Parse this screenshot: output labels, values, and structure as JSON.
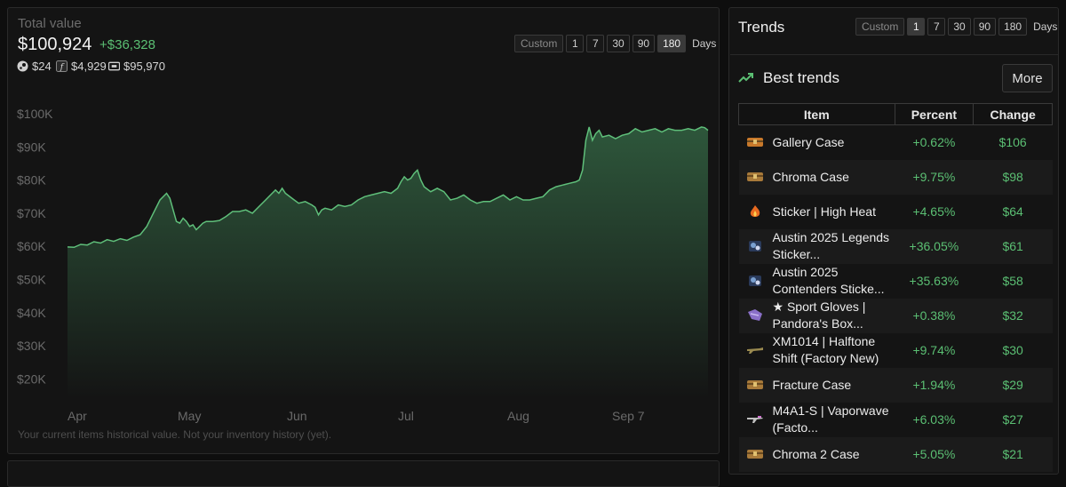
{
  "overview": {
    "total_label": "Total value",
    "total_value": "$100,924",
    "total_delta": "+$36,328",
    "breakdown": [
      {
        "icon": "steam-icon",
        "value": "$24"
      },
      {
        "icon": "skinport-f-icon",
        "value": "$4,929"
      },
      {
        "icon": "wallet-icon",
        "value": "$95,970"
      }
    ],
    "ranges": {
      "custom": "Custom",
      "options": [
        "1",
        "7",
        "30",
        "90",
        "180"
      ],
      "active": "180",
      "unit": "Days"
    },
    "footnote": "Your current items historical value. Not your inventory history (yet)."
  },
  "chart_data": {
    "type": "area",
    "ylabels": [
      "$100K",
      "$90K",
      "$80K",
      "$70K",
      "$60K",
      "$50K",
      "$40K",
      "$30K",
      "$20K"
    ],
    "xlabels": [
      "Apr",
      "May",
      "Jun",
      "Jul",
      "Aug",
      "Sep 7"
    ],
    "ylim": [
      15000,
      100000
    ],
    "x_range_days": [
      0,
      174
    ],
    "xlabel_days": [
      0,
      30,
      60,
      90,
      120,
      149
    ],
    "color": "#5fbf7a",
    "points": [
      [
        0,
        59800
      ],
      [
        2,
        59700
      ],
      [
        4,
        60600
      ],
      [
        6,
        60400
      ],
      [
        8,
        61400
      ],
      [
        10,
        61000
      ],
      [
        12,
        62000
      ],
      [
        14,
        61500
      ],
      [
        16,
        62300
      ],
      [
        18,
        61800
      ],
      [
        20,
        62800
      ],
      [
        22,
        63500
      ],
      [
        24,
        66000
      ],
      [
        26,
        70000
      ],
      [
        28,
        74000
      ],
      [
        30,
        76000
      ],
      [
        31,
        74500
      ],
      [
        32,
        71000
      ],
      [
        33,
        67500
      ],
      [
        34,
        67000
      ],
      [
        35,
        68500
      ],
      [
        36,
        67500
      ],
      [
        37,
        66000
      ],
      [
        38,
        66500
      ],
      [
        39,
        65000
      ],
      [
        40,
        66000
      ],
      [
        41,
        67000
      ],
      [
        42,
        67500
      ],
      [
        44,
        67500
      ],
      [
        46,
        67800
      ],
      [
        48,
        69000
      ],
      [
        50,
        70500
      ],
      [
        52,
        70500
      ],
      [
        54,
        71000
      ],
      [
        56,
        70000
      ],
      [
        58,
        72000
      ],
      [
        60,
        74000
      ],
      [
        62,
        76000
      ],
      [
        63,
        77000
      ],
      [
        64,
        76000
      ],
      [
        65,
        77500
      ],
      [
        66,
        76000
      ],
      [
        68,
        74500
      ],
      [
        70,
        73000
      ],
      [
        72,
        73500
      ],
      [
        74,
        72500
      ],
      [
        75,
        71800
      ],
      [
        76,
        69500
      ],
      [
        77,
        71000
      ],
      [
        78,
        71500
      ],
      [
        80,
        71000
      ],
      [
        82,
        72500
      ],
      [
        84,
        72000
      ],
      [
        86,
        72500
      ],
      [
        88,
        74000
      ],
      [
        90,
        75000
      ],
      [
        92,
        75500
      ],
      [
        94,
        76000
      ],
      [
        96,
        76500
      ],
      [
        98,
        76000
      ],
      [
        100,
        77500
      ],
      [
        101,
        79500
      ],
      [
        102,
        81000
      ],
      [
        103,
        80000
      ],
      [
        104,
        80500
      ],
      [
        105,
        82000
      ],
      [
        106,
        83000
      ],
      [
        107,
        80000
      ],
      [
        108,
        78000
      ],
      [
        110,
        76500
      ],
      [
        112,
        77500
      ],
      [
        114,
        76500
      ],
      [
        116,
        74000
      ],
      [
        118,
        74500
      ],
      [
        120,
        75500
      ],
      [
        122,
        74000
      ],
      [
        124,
        73000
      ],
      [
        126,
        73500
      ],
      [
        128,
        73500
      ],
      [
        130,
        74500
      ],
      [
        132,
        75500
      ],
      [
        134,
        74000
      ],
      [
        136,
        75000
      ],
      [
        138,
        74000
      ],
      [
        140,
        74000
      ],
      [
        142,
        74500
      ],
      [
        144,
        75000
      ],
      [
        146,
        77000
      ],
      [
        148,
        78000
      ],
      [
        150,
        78500
      ],
      [
        152,
        79000
      ],
      [
        154,
        79500
      ],
      [
        155,
        80000
      ],
      [
        156,
        83000
      ],
      [
        157,
        92000
      ],
      [
        158,
        96000
      ],
      [
        159,
        92000
      ],
      [
        160,
        94000
      ],
      [
        161,
        95000
      ],
      [
        162,
        93000
      ],
      [
        164,
        93500
      ],
      [
        166,
        92500
      ],
      [
        168,
        93500
      ],
      [
        170,
        94000
      ],
      [
        172,
        95500
      ],
      [
        174,
        94500
      ],
      [
        176,
        95000
      ],
      [
        178,
        95500
      ],
      [
        180,
        94500
      ],
      [
        182,
        95500
      ],
      [
        184,
        95000
      ],
      [
        186,
        95000
      ],
      [
        188,
        95500
      ],
      [
        190,
        95000
      ],
      [
        192,
        96000
      ],
      [
        193,
        95800
      ],
      [
        194,
        95000
      ]
    ]
  },
  "trends": {
    "title": "Trends",
    "ranges": {
      "custom": "Custom",
      "options": [
        "1",
        "7",
        "30",
        "90",
        "180"
      ],
      "active": "1",
      "unit": "Days"
    },
    "best_title": "Best trends",
    "more_label": "More",
    "headers": [
      "Item",
      "Percent",
      "Change"
    ],
    "rows": [
      {
        "icon": "case-icon",
        "icon_color": "#c8792b",
        "name": "Gallery Case",
        "percent": "+0.62%",
        "change": "$106"
      },
      {
        "icon": "case-icon",
        "icon_color": "#a87a3a",
        "name": "Chroma Case",
        "percent": "+9.75%",
        "change": "$98"
      },
      {
        "icon": "sticker-icon",
        "icon_color": "#e86a20",
        "name": "Sticker | High Heat",
        "percent": "+4.65%",
        "change": "$64"
      },
      {
        "icon": "capsule-icon",
        "icon_color": "#7aa0d0",
        "name": "Austin 2025 Legends Sticker...",
        "percent": "+36.05%",
        "change": "$61"
      },
      {
        "icon": "capsule-icon",
        "icon_color": "#7aa0d0",
        "name": "Austin 2025 Contenders Sticke...",
        "percent": "+35.63%",
        "change": "$58"
      },
      {
        "icon": "gloves-icon",
        "icon_color": "#8a6fc8",
        "name": "★ Sport Gloves | Pandora's Box...",
        "percent": "+0.38%",
        "change": "$32"
      },
      {
        "icon": "shotgun-icon",
        "icon_color": "#9a8a50",
        "name": "XM1014 | Halftone Shift (Factory New)",
        "percent": "+9.74%",
        "change": "$30"
      },
      {
        "icon": "case-icon",
        "icon_color": "#a87a3a",
        "name": "Fracture Case",
        "percent": "+1.94%",
        "change": "$29"
      },
      {
        "icon": "rifle-icon",
        "icon_color": "#c0c0c0",
        "name": "M4A1-S | Vaporwave (Facto...",
        "percent": "+6.03%",
        "change": "$27"
      },
      {
        "icon": "case-icon",
        "icon_color": "#a87a3a",
        "name": "Chroma 2 Case",
        "percent": "+5.05%",
        "change": "$21"
      }
    ]
  }
}
